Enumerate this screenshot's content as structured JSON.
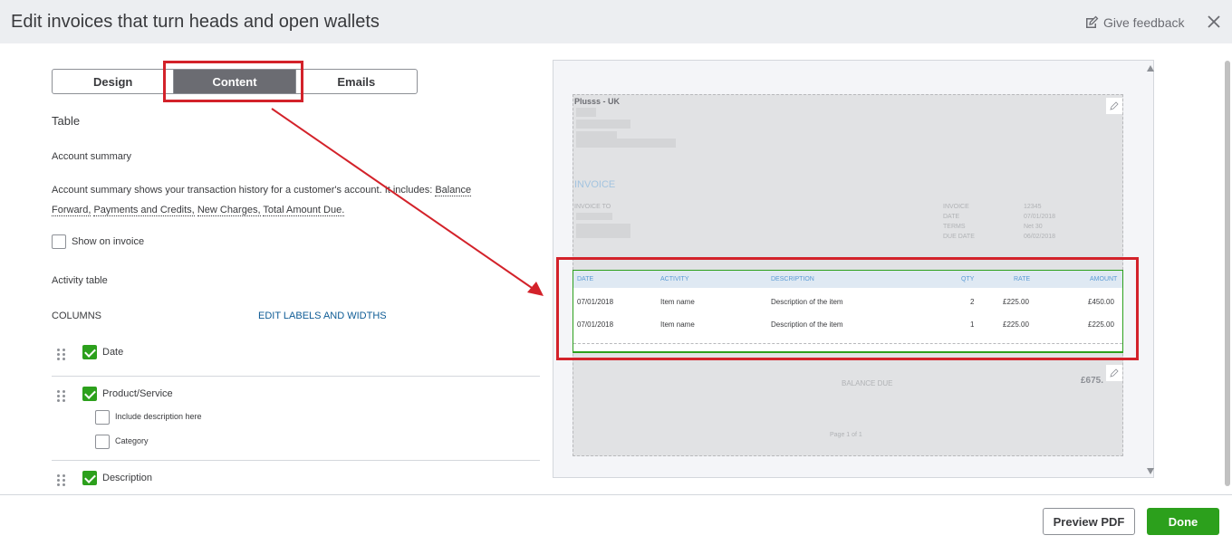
{
  "header": {
    "title": "Edit invoices that turn heads and open wallets",
    "feedback_label": "Give feedback"
  },
  "tabs": [
    {
      "label": "Design"
    },
    {
      "label": "Content"
    },
    {
      "label": "Emails"
    }
  ],
  "panel": {
    "section_title": "Table",
    "account_summary": {
      "heading": "Account summary",
      "desc_prefix": "Account summary shows your transaction history for a customer's account. It includes:",
      "item1": "Balance Forward,",
      "item2": "Payments and Credits,",
      "item3": "New Charges,",
      "item4": "Total Amount Due.",
      "show_label": "Show on invoice"
    },
    "activity_table": {
      "heading": "Activity table",
      "columns_label": "COLUMNS",
      "edit_link": "EDIT LABELS AND WIDTHS",
      "columns": [
        {
          "label": "Date"
        },
        {
          "label": "Product/Service"
        },
        {
          "label": "Description"
        }
      ],
      "sub_options": [
        {
          "label": "Include description here"
        },
        {
          "label": "Category"
        }
      ]
    }
  },
  "invoice": {
    "company": "Plusss - UK",
    "title": "INVOICE",
    "invoice_to": "INVOICE TO",
    "meta_labels": [
      "INVOICE",
      "DATE",
      "TERMS",
      "DUE DATE"
    ],
    "meta_values": [
      "12345",
      "07/01/2018",
      "Net 30",
      "06/02/2018"
    ],
    "table": {
      "headers": [
        "DATE",
        "ACTIVITY",
        "DESCRIPTION",
        "QTY",
        "RATE",
        "AMOUNT"
      ],
      "rows": [
        [
          "07/01/2018",
          "Item name",
          "Description of the item",
          "2",
          "£225.00",
          "£450.00"
        ],
        [
          "07/01/2018",
          "Item name",
          "Description of the item",
          "1",
          "£225.00",
          "£225.00"
        ]
      ]
    },
    "balance_due_label": "BALANCE DUE",
    "balance_due_value": "£675.",
    "page_label": "Page 1 of 1"
  },
  "footer": {
    "preview_label": "Preview PDF",
    "done_label": "Done"
  },
  "colors": {
    "accent_green": "#2ca01c",
    "highlight_red": "#d3222a",
    "link_blue": "#0d5b95"
  }
}
